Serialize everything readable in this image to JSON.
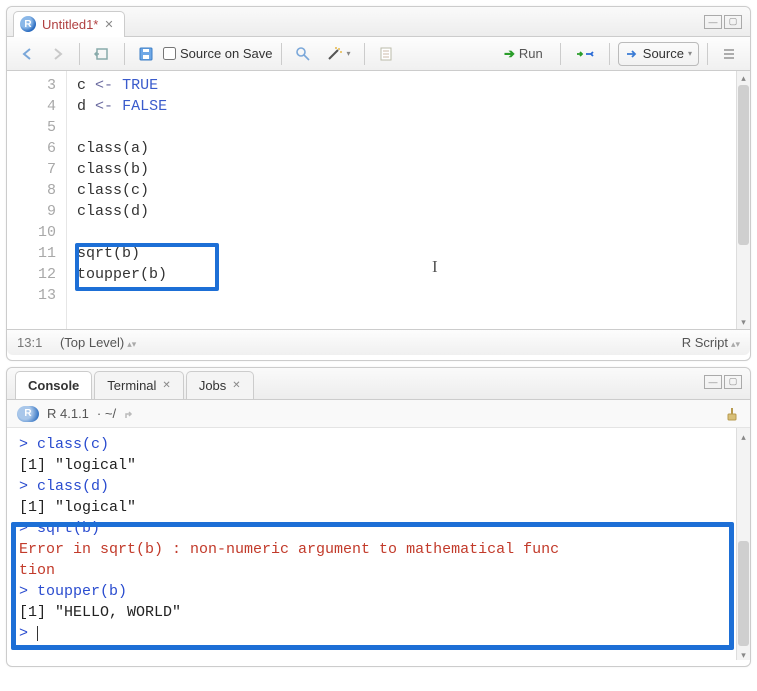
{
  "editor": {
    "tab_title": "Untitled1*",
    "toolbar": {
      "source_on_save": "Source on Save",
      "run": "Run",
      "source": "Source"
    },
    "gutter": [
      "3",
      "4",
      "5",
      "6",
      "7",
      "8",
      "9",
      "10",
      "11",
      "12",
      "13"
    ],
    "lines": {
      "l3_var": "c",
      "l3_op": "<-",
      "l3_val": "TRUE",
      "l4_var": "d",
      "l4_op": "<-",
      "l4_val": "FALSE",
      "l6": "class(a)",
      "l7": "class(b)",
      "l8": "class(c)",
      "l9": "class(d)",
      "l11": "sqrt(b)",
      "l12": "toupper(b)"
    },
    "status": {
      "pos": "13:1",
      "scope": "(Top Level)",
      "lang": "R Script"
    }
  },
  "console": {
    "tabs": {
      "console": "Console",
      "terminal": "Terminal",
      "jobs": "Jobs"
    },
    "info": {
      "version": "R 4.1.1",
      "path": "· ~/"
    },
    "lines": {
      "p1": "> class(c)",
      "o1": "[1] \"logical\"",
      "p2": "> class(d)",
      "o2": "[1] \"logical\"",
      "p3": "> sqrt(b)",
      "e1a": "Error in sqrt(b) : non-numeric argument to mathematical func",
      "e1b": "tion",
      "p4": "> toupper(b)",
      "o4": "[1] \"HELLO, WORLD\"",
      "p5": "> "
    }
  }
}
